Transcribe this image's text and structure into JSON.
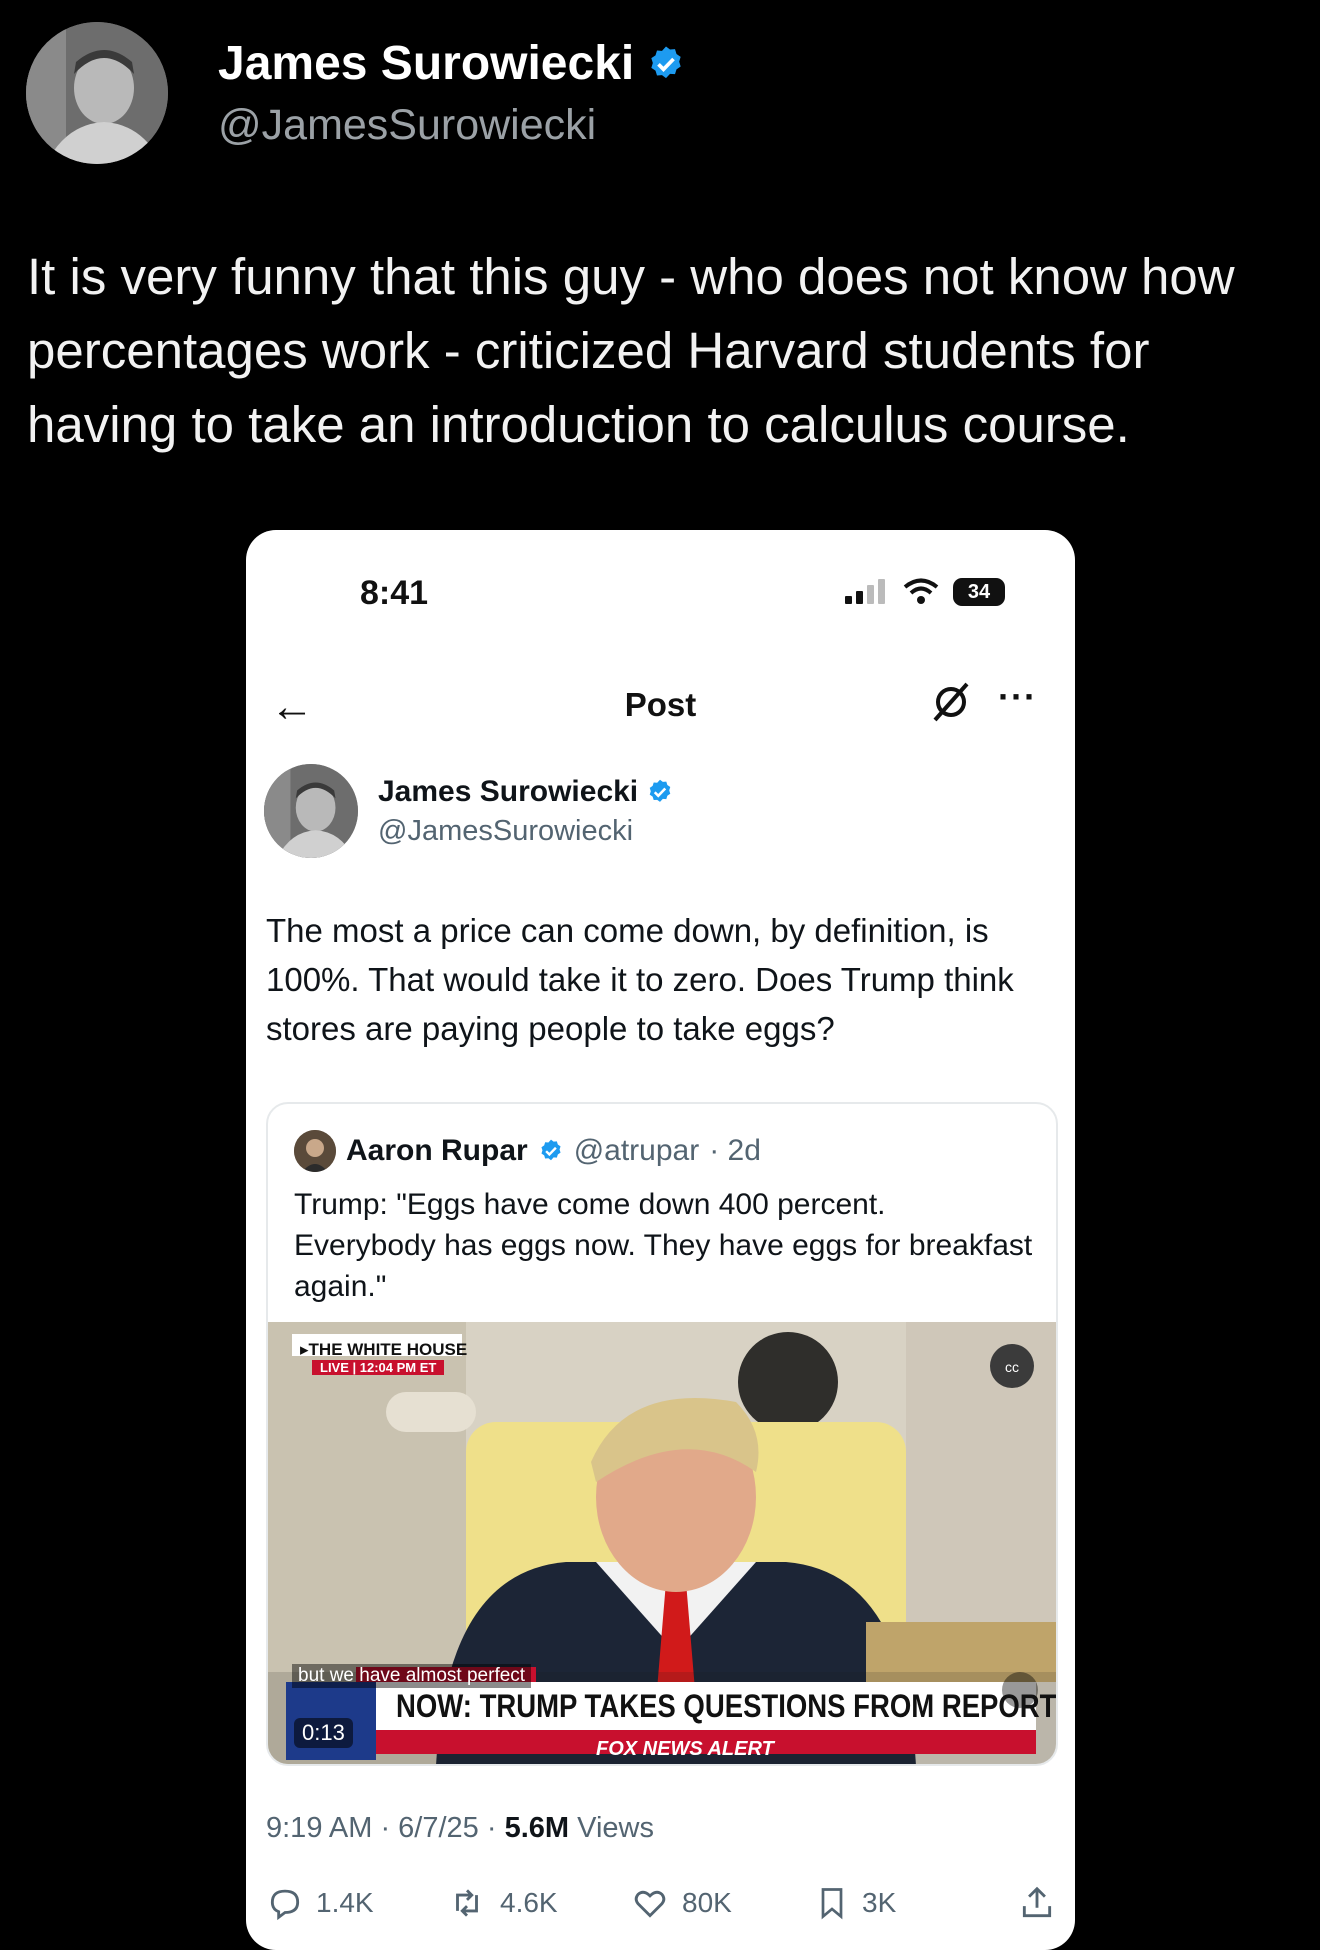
{
  "outer_post": {
    "author_name": "James Surowiecki",
    "handle": "@JamesSurowiecki",
    "text": "It is very funny that this guy - who does not know how percentages work - criticized Harvard students for having to take an introduction to calculus course."
  },
  "phone_screenshot": {
    "status_bar": {
      "time": "8:41",
      "battery": "34"
    },
    "nav": {
      "title": "Post"
    },
    "post": {
      "author_name": "James Surowiecki",
      "handle": "@JamesSurowiecki",
      "text": "The most a price can come down, by definition, is 100%. That would take it to zero. Does Trump think stores are paying people to take eggs?",
      "timestamp": "9:19 AM · 6/7/25 · ",
      "views_count": "5.6M",
      "views_label": " Views"
    },
    "quoted_post": {
      "author_name": "Aaron Rupar",
      "handle": "@atrupar",
      "age": "· 2d",
      "text": "Trump: \"Eggs have come down 400 percent. Everybody has eggs now. They have eggs for breakfast again.\"",
      "video": {
        "source_label": "▸THE WHITE HOUSE",
        "live_label": "LIVE | 12:04 PM ET",
        "caption": "but we have almost perfect",
        "headline": "NOW: TRUMP TAKES QUESTIONS FROM REPORTERS",
        "alert": "FOX NEWS ALERT",
        "elapsed": "0:13"
      }
    },
    "actions": {
      "replies": "1.4K",
      "reposts": "4.6K",
      "likes": "80K",
      "bookmarks": "3K"
    }
  },
  "colors": {
    "verified": "#1d9bf0",
    "background": "#000000",
    "card": "#ffffff",
    "fox_red": "#c8102e"
  }
}
